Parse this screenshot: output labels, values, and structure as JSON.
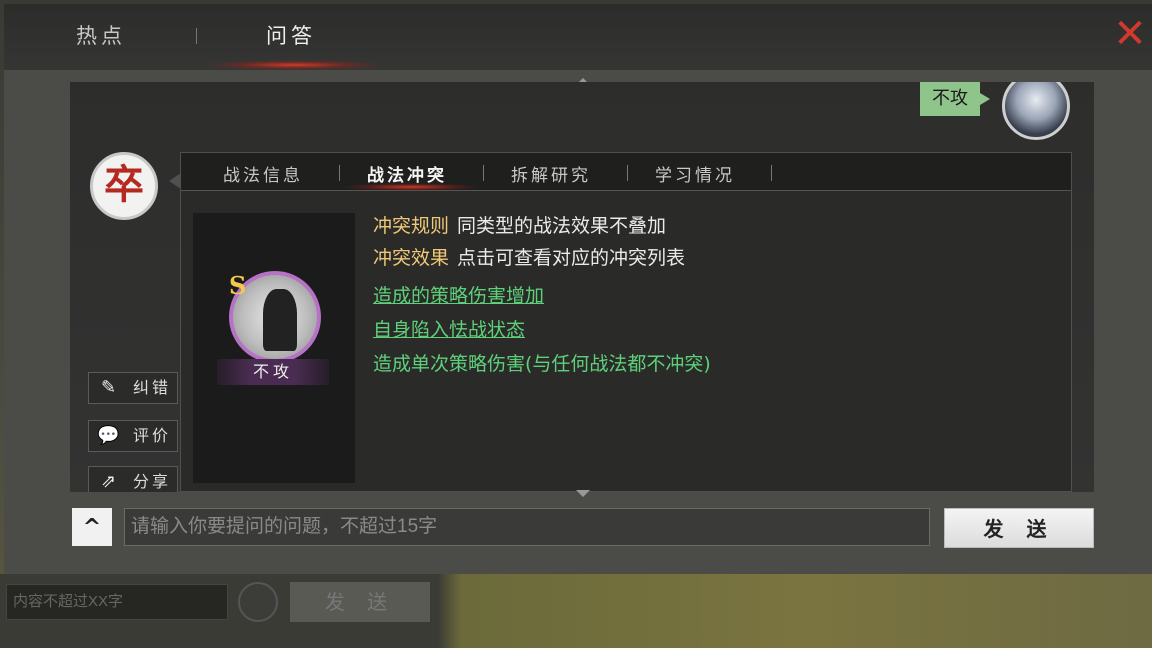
{
  "background": {
    "input_placeholder": "内容不超过XX字",
    "send_label": "发 送"
  },
  "top_tabs": [
    {
      "label": "热点",
      "active": false
    },
    {
      "label": "问答",
      "active": true
    }
  ],
  "close_icon": "close-x-icon",
  "user_message": {
    "text": "不攻",
    "avatar": "general-portrait"
  },
  "bot": {
    "avatar_char": "卒"
  },
  "side_buttons": [
    {
      "label": "纠错",
      "icon": "edit-icon"
    },
    {
      "label": "评价",
      "icon": "chat-bubble-icon"
    },
    {
      "label": "分享",
      "icon": "share-icon"
    }
  ],
  "sub_tabs": [
    {
      "label": "战法信息",
      "active": false
    },
    {
      "label": "战法冲突",
      "active": true
    },
    {
      "label": "拆解研究",
      "active": false
    },
    {
      "label": "学习情况",
      "active": false
    }
  ],
  "skill": {
    "grade": "S",
    "name": "不攻",
    "grade_color": "#f2c94c",
    "frame_color": "#b572c6"
  },
  "conflict": {
    "rule_key": "冲突规则",
    "rule_value": "同类型的战法效果不叠加",
    "effect_key": "冲突效果",
    "effect_value": "点击可查看对应的冲突列表",
    "effects": [
      {
        "text": "造成的策略伤害增加",
        "link": true
      },
      {
        "text": "自身陷入怯战状态",
        "link": true
      },
      {
        "text": "造成单次策略伤害(与任何战法都不冲突)",
        "link": false
      }
    ],
    "key_color": "#f0c878",
    "effect_color": "#5fd07a"
  },
  "input": {
    "placeholder": "请输入你要提问的问题，不超过15字",
    "value": ""
  },
  "send_button": "发 送",
  "expand_icon": "^"
}
